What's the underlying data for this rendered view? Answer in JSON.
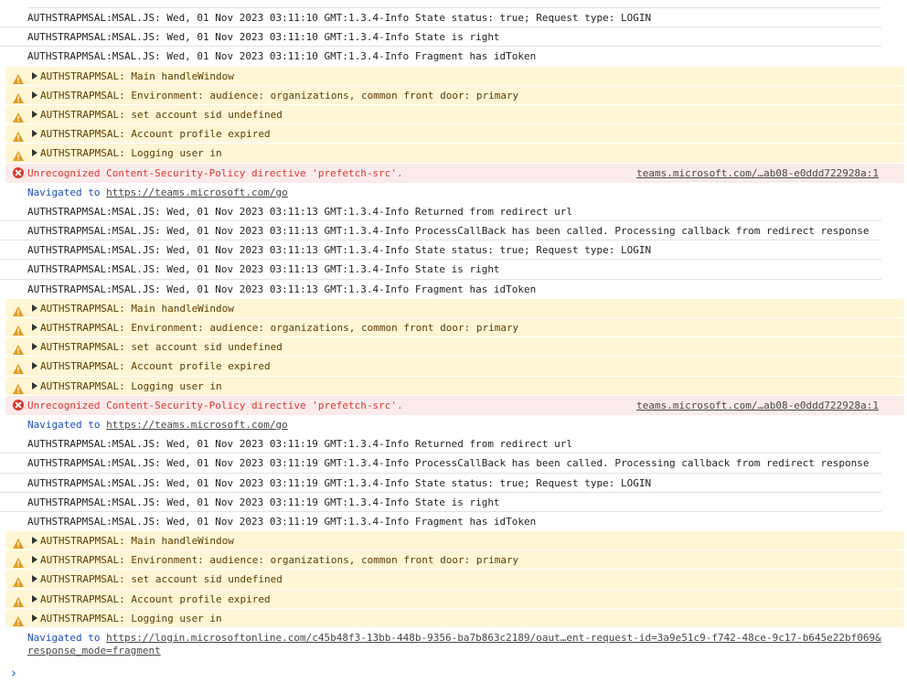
{
  "colors": {
    "warning_bg": "#fef6d5",
    "error_bg": "#fcebeb",
    "error_text": "#dc362e",
    "navigated_label": "#1f4dba"
  },
  "icons": {
    "warning": "warning-triangle-icon",
    "error": "error-circle-icon",
    "expand": "expand-triangle-icon",
    "prompt": "chevron-right-icon"
  },
  "rows": [
    {
      "type": "log",
      "text": "AUTHSTRAPMSAL:MSAL.JS: Wed, 01 Nov 2023 03:11:10 GMT:1.3.4-Info State status: true; Request type: LOGIN"
    },
    {
      "type": "log",
      "text": "AUTHSTRAPMSAL:MSAL.JS: Wed, 01 Nov 2023 03:11:10 GMT:1.3.4-Info State is right"
    },
    {
      "type": "log",
      "text": "AUTHSTRAPMSAL:MSAL.JS: Wed, 01 Nov 2023 03:11:10 GMT:1.3.4-Info Fragment has idToken"
    },
    {
      "type": "warn",
      "text": "AUTHSTRAPMSAL: Main handleWindow"
    },
    {
      "type": "warn",
      "text": "AUTHSTRAPMSAL: Environment: audience: organizations, common front door: primary"
    },
    {
      "type": "warn",
      "text": "AUTHSTRAPMSAL: set account sid undefined"
    },
    {
      "type": "warn",
      "text": "AUTHSTRAPMSAL: Account profile expired"
    },
    {
      "type": "warn",
      "text": "AUTHSTRAPMSAL: Logging user in"
    },
    {
      "type": "error",
      "text": "Unrecognized Content-Security-Policy directive 'prefetch-src'.",
      "source": "teams.microsoft.com/…ab08-e0ddd722928a:1"
    },
    {
      "type": "nav",
      "label": "Navigated to",
      "url": "https://teams.microsoft.com/go"
    },
    {
      "type": "log",
      "text": "AUTHSTRAPMSAL:MSAL.JS: Wed, 01 Nov 2023 03:11:13 GMT:1.3.4-Info Returned from redirect url"
    },
    {
      "type": "log",
      "text": "AUTHSTRAPMSAL:MSAL.JS: Wed, 01 Nov 2023 03:11:13 GMT:1.3.4-Info ProcessCallBack has been called. Processing callback from redirect response"
    },
    {
      "type": "log",
      "text": "AUTHSTRAPMSAL:MSAL.JS: Wed, 01 Nov 2023 03:11:13 GMT:1.3.4-Info State status: true; Request type: LOGIN"
    },
    {
      "type": "log",
      "text": "AUTHSTRAPMSAL:MSAL.JS: Wed, 01 Nov 2023 03:11:13 GMT:1.3.4-Info State is right"
    },
    {
      "type": "log",
      "text": "AUTHSTRAPMSAL:MSAL.JS: Wed, 01 Nov 2023 03:11:13 GMT:1.3.4-Info Fragment has idToken"
    },
    {
      "type": "warn",
      "text": "AUTHSTRAPMSAL: Main handleWindow"
    },
    {
      "type": "warn",
      "text": "AUTHSTRAPMSAL: Environment: audience: organizations, common front door: primary"
    },
    {
      "type": "warn",
      "text": "AUTHSTRAPMSAL: set account sid undefined"
    },
    {
      "type": "warn",
      "text": "AUTHSTRAPMSAL: Account profile expired"
    },
    {
      "type": "warn",
      "text": "AUTHSTRAPMSAL: Logging user in"
    },
    {
      "type": "error",
      "text": "Unrecognized Content-Security-Policy directive 'prefetch-src'.",
      "source": "teams.microsoft.com/…ab08-e0ddd722928a:1"
    },
    {
      "type": "nav",
      "label": "Navigated to",
      "url": "https://teams.microsoft.com/go"
    },
    {
      "type": "log",
      "text": "AUTHSTRAPMSAL:MSAL.JS: Wed, 01 Nov 2023 03:11:19 GMT:1.3.4-Info Returned from redirect url"
    },
    {
      "type": "log",
      "text": "AUTHSTRAPMSAL:MSAL.JS: Wed, 01 Nov 2023 03:11:19 GMT:1.3.4-Info ProcessCallBack has been called. Processing callback from redirect response"
    },
    {
      "type": "log",
      "text": "AUTHSTRAPMSAL:MSAL.JS: Wed, 01 Nov 2023 03:11:19 GMT:1.3.4-Info State status: true; Request type: LOGIN"
    },
    {
      "type": "log",
      "text": "AUTHSTRAPMSAL:MSAL.JS: Wed, 01 Nov 2023 03:11:19 GMT:1.3.4-Info State is right"
    },
    {
      "type": "log",
      "text": "AUTHSTRAPMSAL:MSAL.JS: Wed, 01 Nov 2023 03:11:19 GMT:1.3.4-Info Fragment has idToken"
    },
    {
      "type": "warn",
      "text": "AUTHSTRAPMSAL: Main handleWindow"
    },
    {
      "type": "warn",
      "text": "AUTHSTRAPMSAL: Environment: audience: organizations, common front door: primary"
    },
    {
      "type": "warn",
      "text": "AUTHSTRAPMSAL: set account sid undefined"
    },
    {
      "type": "warn",
      "text": "AUTHSTRAPMSAL: Account profile expired"
    },
    {
      "type": "warn",
      "text": "AUTHSTRAPMSAL: Logging user in"
    },
    {
      "type": "nav",
      "label": "Navigated to",
      "url": "https://login.microsoftonline.com/c45b48f3-13bb-448b-9356-ba7b863c2189/oaut…ent-request-id=3a9e51c9-f742-48ce-9c17-b645e22bf069&response_mode=fragment"
    }
  ]
}
